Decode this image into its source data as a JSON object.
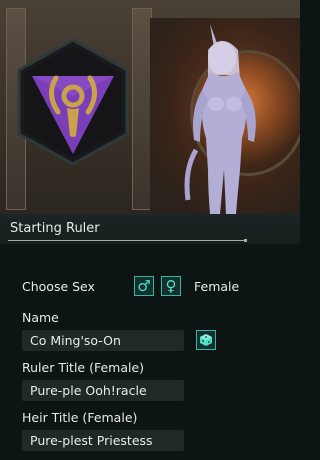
{
  "panel": {
    "title": "Starting Ruler"
  },
  "sex": {
    "label": "Choose Sex",
    "male_icon": "male-symbol-icon",
    "female_icon": "female-symbol-icon",
    "value": "Female"
  },
  "name": {
    "label": "Name",
    "value": "Co Ming'so-On",
    "randomize_icon": "dice-icon"
  },
  "ruler_title": {
    "label": "Ruler Title (Female)",
    "value": "Pure-ple Ooh!racle"
  },
  "heir_title": {
    "label": "Heir Title (Female)",
    "value": "Pure-plest Priestess"
  },
  "colors": {
    "accent": "#3fb3a2",
    "emblem_purple": "#7a3fb8",
    "emblem_gold": "#c9a24a"
  }
}
